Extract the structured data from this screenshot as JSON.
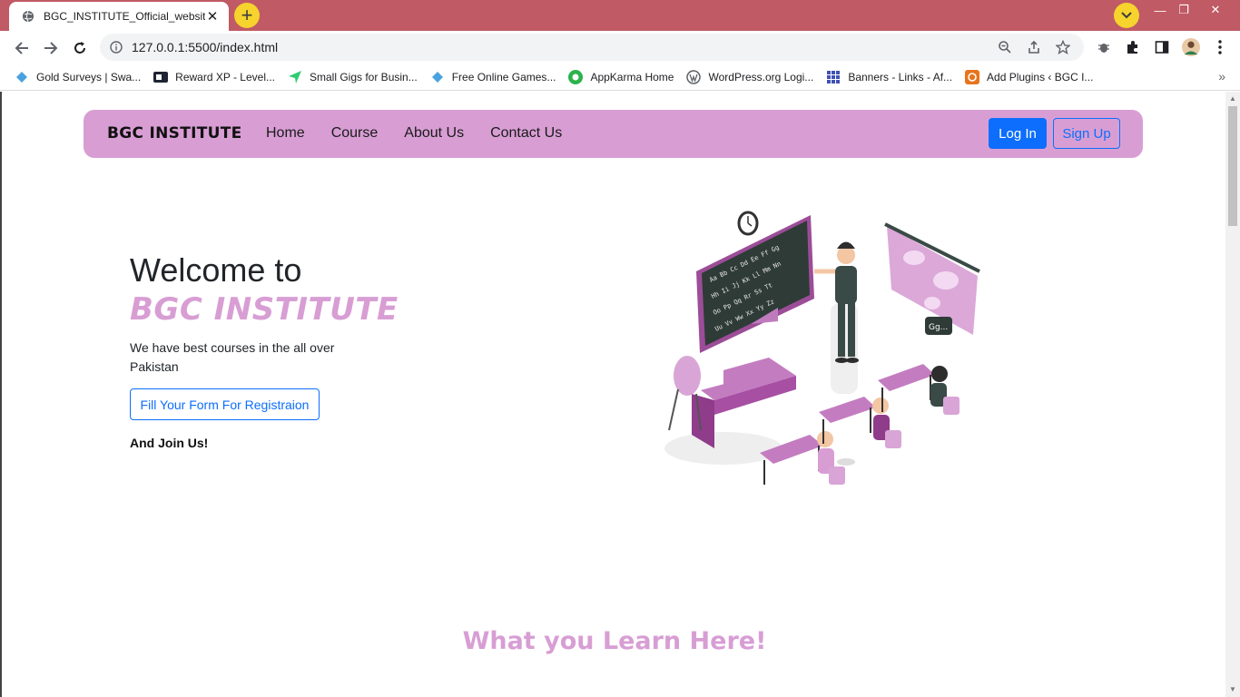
{
  "browser": {
    "tab_title": "BGC_INSTITUTE_Official_website",
    "url": "127.0.0.1:5500/index.html",
    "accent_titlebar": "#c05a65",
    "bookmarks": [
      {
        "label": "Gold Surveys | Swa...",
        "icon": "diamond-icon"
      },
      {
        "label": "Reward XP - Level...",
        "icon": "xp-icon"
      },
      {
        "label": "Small Gigs for Busin...",
        "icon": "arrow-icon"
      },
      {
        "label": "Free Online Games...",
        "icon": "diamond-icon"
      },
      {
        "label": "AppKarma Home",
        "icon": "appkarma-icon"
      },
      {
        "label": "WordPress.org Logi...",
        "icon": "wordpress-icon"
      },
      {
        "label": "Banners - Links - Af...",
        "icon": "grid-icon"
      },
      {
        "label": "Add Plugins ‹ BGC I...",
        "icon": "plugin-icon"
      }
    ]
  },
  "page": {
    "navbar": {
      "brand": "BGC INSTITUTE",
      "links": [
        "Home",
        "Course",
        "About Us",
        "Contact Us"
      ],
      "login": "Log In",
      "signup": "Sign Up",
      "bg_color": "#d89ed4"
    },
    "hero": {
      "welcome": "Welcome to",
      "brand": "BGC INSTITUTE",
      "text": "We have best courses in the all over Pakistan",
      "cta": "Fill Your Form For Registraion",
      "join": "And Join Us!"
    },
    "section_heading": "What you Learn Here!",
    "colors": {
      "primary": "#0d6efd",
      "accent": "#d89ed4"
    }
  }
}
